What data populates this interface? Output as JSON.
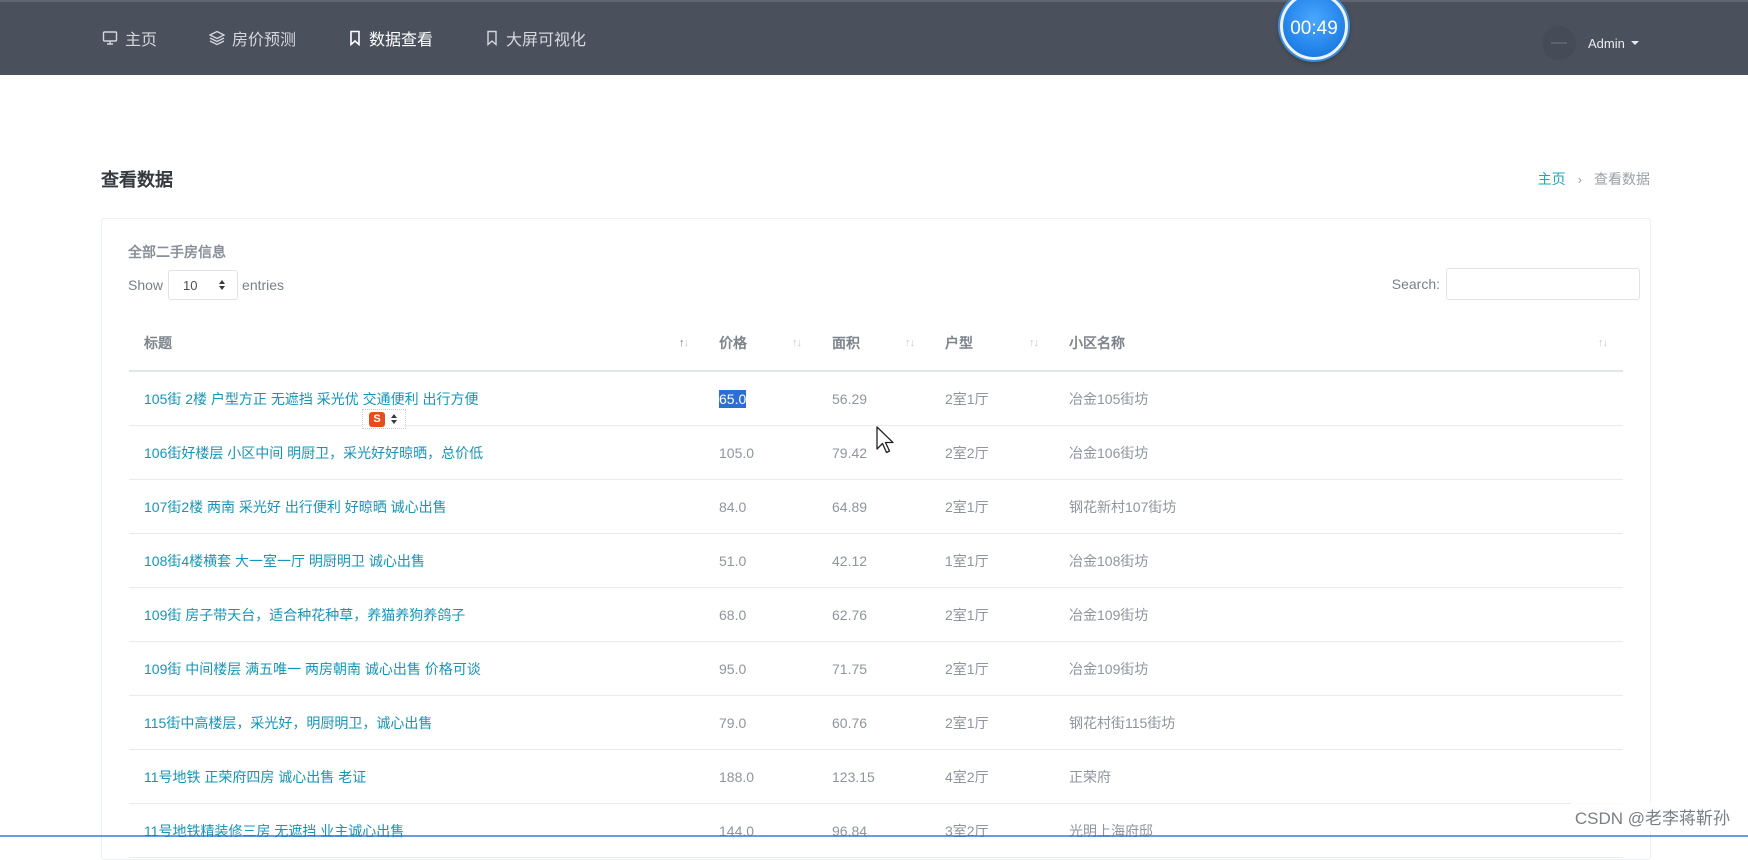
{
  "nav": {
    "items": [
      {
        "label": "主页",
        "icon": "monitor-icon"
      },
      {
        "label": "房价预测",
        "icon": "layers-icon"
      },
      {
        "label": "数据查看",
        "icon": "bookmark-icon"
      },
      {
        "label": "大屏可视化",
        "icon": "bookmark-icon"
      }
    ],
    "active": "数据查看"
  },
  "timer": "00:49",
  "user": {
    "name": "Admin"
  },
  "page": {
    "title": "查看数据"
  },
  "breadcrumb": {
    "home": "主页",
    "separator": "›",
    "current": "查看数据"
  },
  "card": {
    "title": "全部二手房信息"
  },
  "length": {
    "show": "Show",
    "value": "10",
    "entries": "entries"
  },
  "search": {
    "label": "Search:",
    "value": "",
    "placeholder": ""
  },
  "table": {
    "columns": [
      "标题",
      "价格",
      "面积",
      "户型",
      "小区名称"
    ],
    "rows": [
      [
        "105街 2楼 户型方正 无遮挡 采光优 交通便利 出行方便",
        "65.0",
        "56.29",
        "2室1厅",
        "冶金105街坊"
      ],
      [
        "106街好楼层 小区中间 明厨卫，采光好好晾晒，总价低",
        "105.0",
        "79.42",
        "2室2厅",
        "冶金106街坊"
      ],
      [
        "107街2楼 两南 采光好 出行便利 好晾晒 诚心出售",
        "84.0",
        "64.89",
        "2室1厅",
        "钢花新村107街坊"
      ],
      [
        "108街4楼横套 大一室一厅 明厨明卫 诚心出售",
        "51.0",
        "42.12",
        "1室1厅",
        "冶金108街坊"
      ],
      [
        "109街 房子带天台，适合种花种草，养猫养狗养鸽子",
        "68.0",
        "62.76",
        "2室1厅",
        "冶金109街坊"
      ],
      [
        "109街 中间楼层 满五唯一 两房朝南 诚心出售 价格可谈",
        "95.0",
        "71.75",
        "2室1厅",
        "冶金109街坊"
      ],
      [
        "115街中高楼层，采光好，明厨明卫，诚心出售",
        "79.0",
        "60.76",
        "2室1厅",
        "钢花村街115街坊"
      ],
      [
        "11号地铁 正荣府四房 诚心出售 老证",
        "188.0",
        "123.15",
        "4室2厅",
        "正荣府"
      ],
      [
        "11号地铁精装修三房 无遮挡 业主诚心出售",
        "144.0",
        "96.84",
        "3室2厅",
        "光明上海府邸"
      ]
    ]
  },
  "ime": {
    "logo": "S"
  },
  "watermark": "CSDN @老李蒋靳孙",
  "colors": {
    "topbar": "#4a505c",
    "link": "#1795b8",
    "highlight": "#2b6fd6",
    "timer": "#1f7fe6"
  }
}
